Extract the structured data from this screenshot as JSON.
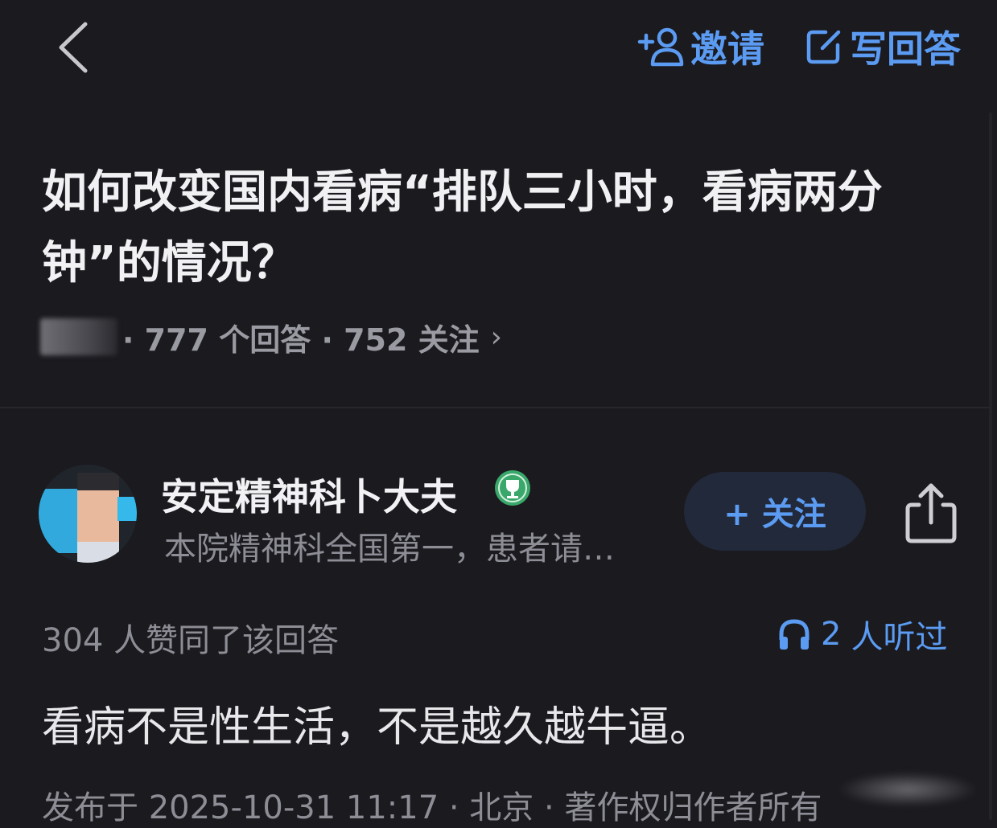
{
  "header": {
    "invite_label": "邀请",
    "write_label": "写回答"
  },
  "question": {
    "title": "如何改变国内看病“排队三小时，看病两分钟”的情况？",
    "meta_text": "· 777  个回答 · 752  关注",
    "meta_chevron": "›"
  },
  "author": {
    "name": "安定精神科卜大夫",
    "bio": "本院精神科全国第一，患者请…",
    "follow_label": "+ 关注"
  },
  "stats": {
    "votes_text": "304  人赞同了该回答",
    "listen_count": "2",
    "listen_text": "人听过"
  },
  "answer": {
    "text": "看病不是性生活，不是越久越牛逼。"
  },
  "footer": {
    "text": "发布于  2025-10-31  11:17 · 北京 · 著作权归作者所有"
  },
  "icons": {
    "back": "back-chevron-icon",
    "invite": "add-person-icon",
    "write": "edit-icon",
    "badge": "trophy-badge-icon",
    "share": "share-icon",
    "listen": "headphones-icon"
  },
  "colors": {
    "background": "#1a1a1f",
    "accent": "#5b9bf2",
    "text_primary": "#f1f1f3",
    "text_secondary": "#8d8d95",
    "badge_green": "#3aa86b"
  }
}
